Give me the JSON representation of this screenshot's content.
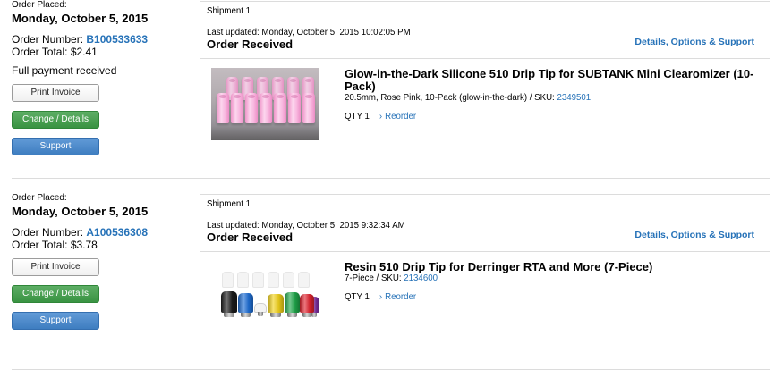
{
  "theme": {
    "link_color": "#2672b8",
    "change_button_color": "#3e9e47",
    "support_button_color": "#4387cf",
    "divider_color": "#dcdcdc"
  },
  "orders": [
    {
      "placed_label": "Order Placed:",
      "placed_date": "Monday, October 5, 2015",
      "number_label": "Order Number:",
      "number": "B100533633",
      "total_label": "Order Total:",
      "total": "$2.41",
      "payment_status": "Full payment received",
      "actions": {
        "print_invoice": "Print Invoice",
        "change_details": "Change / Details",
        "support": "Support"
      },
      "shipment": {
        "title": "Shipment 1",
        "last_updated_label": "Last updated:",
        "last_updated": "Monday, October 5, 2015 10:02:05 PM",
        "status": "Order Received",
        "details_link": "Details, Options & Support",
        "items": [
          {
            "title": "Glow-in-the-Dark Silicone 510 Drip Tip for SUBTANK Mini Clearomizer (10-Pack)",
            "options": "20.5mm, Rose Pink, 10-Pack (glow-in-the-dark) /",
            "sku_label": "SKU:",
            "sku": "2349501",
            "qty_label": "QTY",
            "qty": "1",
            "reorder_label": "Reorder",
            "reorder_icon": "chevron-right-icon"
          }
        ]
      }
    },
    {
      "placed_label": "Order Placed:",
      "placed_date": "Monday, October 5, 2015",
      "number_label": "Order Number:",
      "number": "A100536308",
      "total_label": "Order Total:",
      "total": "$3.78",
      "actions": {
        "print_invoice": "Print Invoice",
        "change_details": "Change / Details",
        "support": "Support"
      },
      "shipment": {
        "title": "Shipment 1",
        "last_updated_label": "Last updated:",
        "last_updated": "Monday, October 5, 2015 9:32:34 AM",
        "status": "Order Received",
        "details_link": "Details, Options & Support",
        "items": [
          {
            "title": "Resin 510 Drip Tip for Derringer RTA and More (7-Piece)",
            "options": "7-Piece /",
            "sku_label": "SKU:",
            "sku": "2134600",
            "qty_label": "QTY",
            "qty": "1",
            "reorder_label": "Reorder",
            "reorder_icon": "chevron-right-icon"
          }
        ]
      }
    }
  ]
}
